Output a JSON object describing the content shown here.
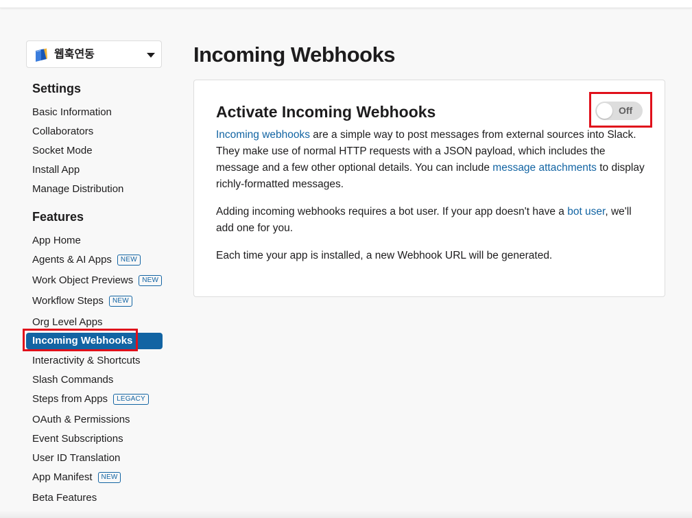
{
  "app_selector": {
    "name": "웹훅연동",
    "icon": "book-icon"
  },
  "sidebar": {
    "settings_title": "Settings",
    "settings_items": [
      {
        "label": "Basic Information"
      },
      {
        "label": "Collaborators"
      },
      {
        "label": "Socket Mode"
      },
      {
        "label": "Install App"
      },
      {
        "label": "Manage Distribution"
      }
    ],
    "features_title": "Features",
    "features_items": [
      {
        "label": "App Home",
        "badge": ""
      },
      {
        "label": "Agents & AI Apps",
        "badge": "NEW"
      },
      {
        "label": "Work Object Previews",
        "badge": "NEW"
      },
      {
        "label": "Workflow Steps",
        "badge": "NEW"
      },
      {
        "label": "Org Level Apps",
        "badge": ""
      },
      {
        "label": "Incoming Webhooks",
        "badge": "",
        "active": true
      },
      {
        "label": "Interactivity & Shortcuts",
        "badge": ""
      },
      {
        "label": "Slash Commands",
        "badge": ""
      },
      {
        "label": "Steps from Apps",
        "badge": "LEGACY"
      },
      {
        "label": "OAuth & Permissions",
        "badge": ""
      },
      {
        "label": "Event Subscriptions",
        "badge": ""
      },
      {
        "label": "User ID Translation",
        "badge": ""
      },
      {
        "label": "App Manifest",
        "badge": "NEW"
      },
      {
        "label": "Beta Features",
        "badge": ""
      }
    ]
  },
  "main": {
    "page_title": "Incoming Webhooks",
    "card": {
      "title": "Activate Incoming Webhooks",
      "toggle_label": "Off",
      "toggle_on": false,
      "p1_link1": "Incoming webhooks",
      "p1_text1": " are a simple way to post messages from external sources into Slack. They make use of normal HTTP requests with a JSON payload, which includes the message and a few other optional details. You can include ",
      "p1_link2": "message attachments",
      "p1_text2": " to display richly-formatted messages.",
      "p2_text1": "Adding incoming webhooks requires a bot user. If your app doesn't have a ",
      "p2_link": "bot user",
      "p2_text2": ", we'll add one for you.",
      "p3_text": "Each time your app is installed, a new Webhook URL will be generated."
    }
  },
  "colors": {
    "accent": "#1264a3",
    "highlight": "#e0101b",
    "text": "#1d1c1d"
  }
}
